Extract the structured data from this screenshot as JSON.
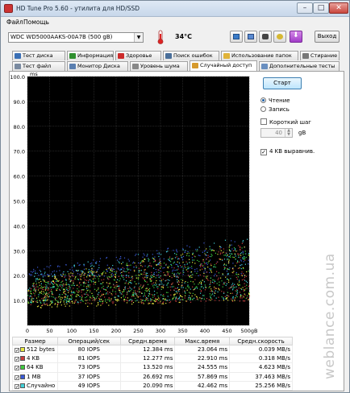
{
  "window": {
    "title": "HD Tune Pro 5.60 - утилита для HD/SSD",
    "controls": {
      "minimize": "–",
      "maximize": "□",
      "close": "✕"
    }
  },
  "menu": [
    "Файл",
    "Помощь"
  ],
  "toolbar": {
    "drive": "WDC WD5000AAKS-00A7B (500 gB)",
    "temperature": "34°C",
    "exit_label": "Выход",
    "icons": [
      "copy-icon",
      "save-icon",
      "camera-icon",
      "key-icon",
      "download-icon"
    ]
  },
  "tabs_row1": [
    {
      "label": "Тест диска",
      "icon": "benchmark-icon",
      "color": "#3a6fb5"
    },
    {
      "label": "Информация",
      "icon": "info-icon",
      "color": "#2f8f2f"
    },
    {
      "label": "Здоровье",
      "icon": "health-icon",
      "color": "#cc2b2b"
    },
    {
      "label": "Поиск ошибок",
      "icon": "search-icon",
      "color": "#4a6f9a"
    },
    {
      "label": "Использование папок",
      "icon": "folder-icon",
      "color": "#e0b33a"
    },
    {
      "label": "Стирание",
      "icon": "erase-icon",
      "color": "#777777"
    }
  ],
  "tabs_row2": [
    {
      "label": "Тест файл",
      "icon": "file-icon",
      "color": "#7a8aa0"
    },
    {
      "label": "Монитор Диска",
      "icon": "monitor-icon",
      "color": "#5a7fb0"
    },
    {
      "label": "Уровень шума",
      "icon": "speaker-icon",
      "color": "#888888"
    },
    {
      "label": "Случайный доступ",
      "icon": "random-icon",
      "color": "#d69a2d",
      "active": true
    },
    {
      "label": "Дополнительные тесты",
      "icon": "extra-tests-icon",
      "color": "#6a8fc0"
    }
  ],
  "controls": {
    "start_label": "Старт",
    "read_label": "Чтение",
    "write_label": "Запись",
    "short_step_label": "Короткий шаг",
    "step_value": "40",
    "step_unit": "gB",
    "align_label": "4 KB выравнив.",
    "read_selected": true,
    "short_step_checked": false,
    "align_checked": true
  },
  "chart_data": {
    "type": "scatter",
    "ylabel": "ms",
    "xlabel": "gB",
    "xlim": [
      0,
      500
    ],
    "ylim": [
      0,
      100
    ],
    "y_ticks": [
      "100.0",
      "90.0",
      "80.0",
      "70.0",
      "60.0",
      "50.0",
      "40.0",
      "30.0",
      "20.0",
      "10.0"
    ],
    "x_ticks": [
      "0",
      "50",
      "100",
      "150",
      "200",
      "250",
      "300",
      "350",
      "400",
      "450",
      "500gB"
    ],
    "grid": true,
    "series": [
      {
        "name": "512 bytes",
        "color": "#e8e840",
        "band_low": [
          7,
          19
        ],
        "band_high": [
          10,
          34
        ]
      },
      {
        "name": "4 KB",
        "color": "#c83c3c",
        "band_low": [
          8,
          17
        ],
        "band_high": [
          10,
          34
        ]
      },
      {
        "name": "64 KB",
        "color": "#3ccc3c",
        "band_low": [
          9,
          18
        ],
        "band_high": [
          11,
          34
        ]
      },
      {
        "name": "1 MB",
        "color": "#3a5ad8",
        "band_low": [
          20,
          23
        ],
        "band_high": [
          20,
          36
        ]
      },
      {
        "name": "Случайно",
        "color": "#40d0d8",
        "band_low": [
          9,
          22
        ],
        "band_high": [
          11,
          36
        ]
      }
    ]
  },
  "table": {
    "headers": [
      "Размер",
      "Операций/сек",
      "Средн.время",
      "Макс.время",
      "Средн.скорость"
    ],
    "rows": [
      {
        "checked": true,
        "color": "#e8e840",
        "size": "512 bytes",
        "iops": "80 IOPS",
        "avg": "12.384 ms",
        "max": "23.064 ms",
        "speed": "0.039 MB/s"
      },
      {
        "checked": true,
        "color": "#c83c3c",
        "size": "4 KB",
        "iops": "81 IOPS",
        "avg": "12.277 ms",
        "max": "22.910 ms",
        "speed": "0.318 MB/s"
      },
      {
        "checked": true,
        "color": "#3ccc3c",
        "size": "64 KB",
        "iops": "73 IOPS",
        "avg": "13.520 ms",
        "max": "24.555 ms",
        "speed": "4.623 MB/s"
      },
      {
        "checked": true,
        "color": "#3a5ad8",
        "size": "1 MB",
        "iops": "37 IOPS",
        "avg": "26.692 ms",
        "max": "57.869 ms",
        "speed": "37.463 MB/s"
      },
      {
        "checked": true,
        "color": "#40d0d8",
        "size": "Случайно",
        "iops": "49 IOPS",
        "avg": "20.090 ms",
        "max": "42.462 ms",
        "speed": "25.256 MB/s"
      }
    ]
  },
  "watermark": "weblance.com.ua"
}
